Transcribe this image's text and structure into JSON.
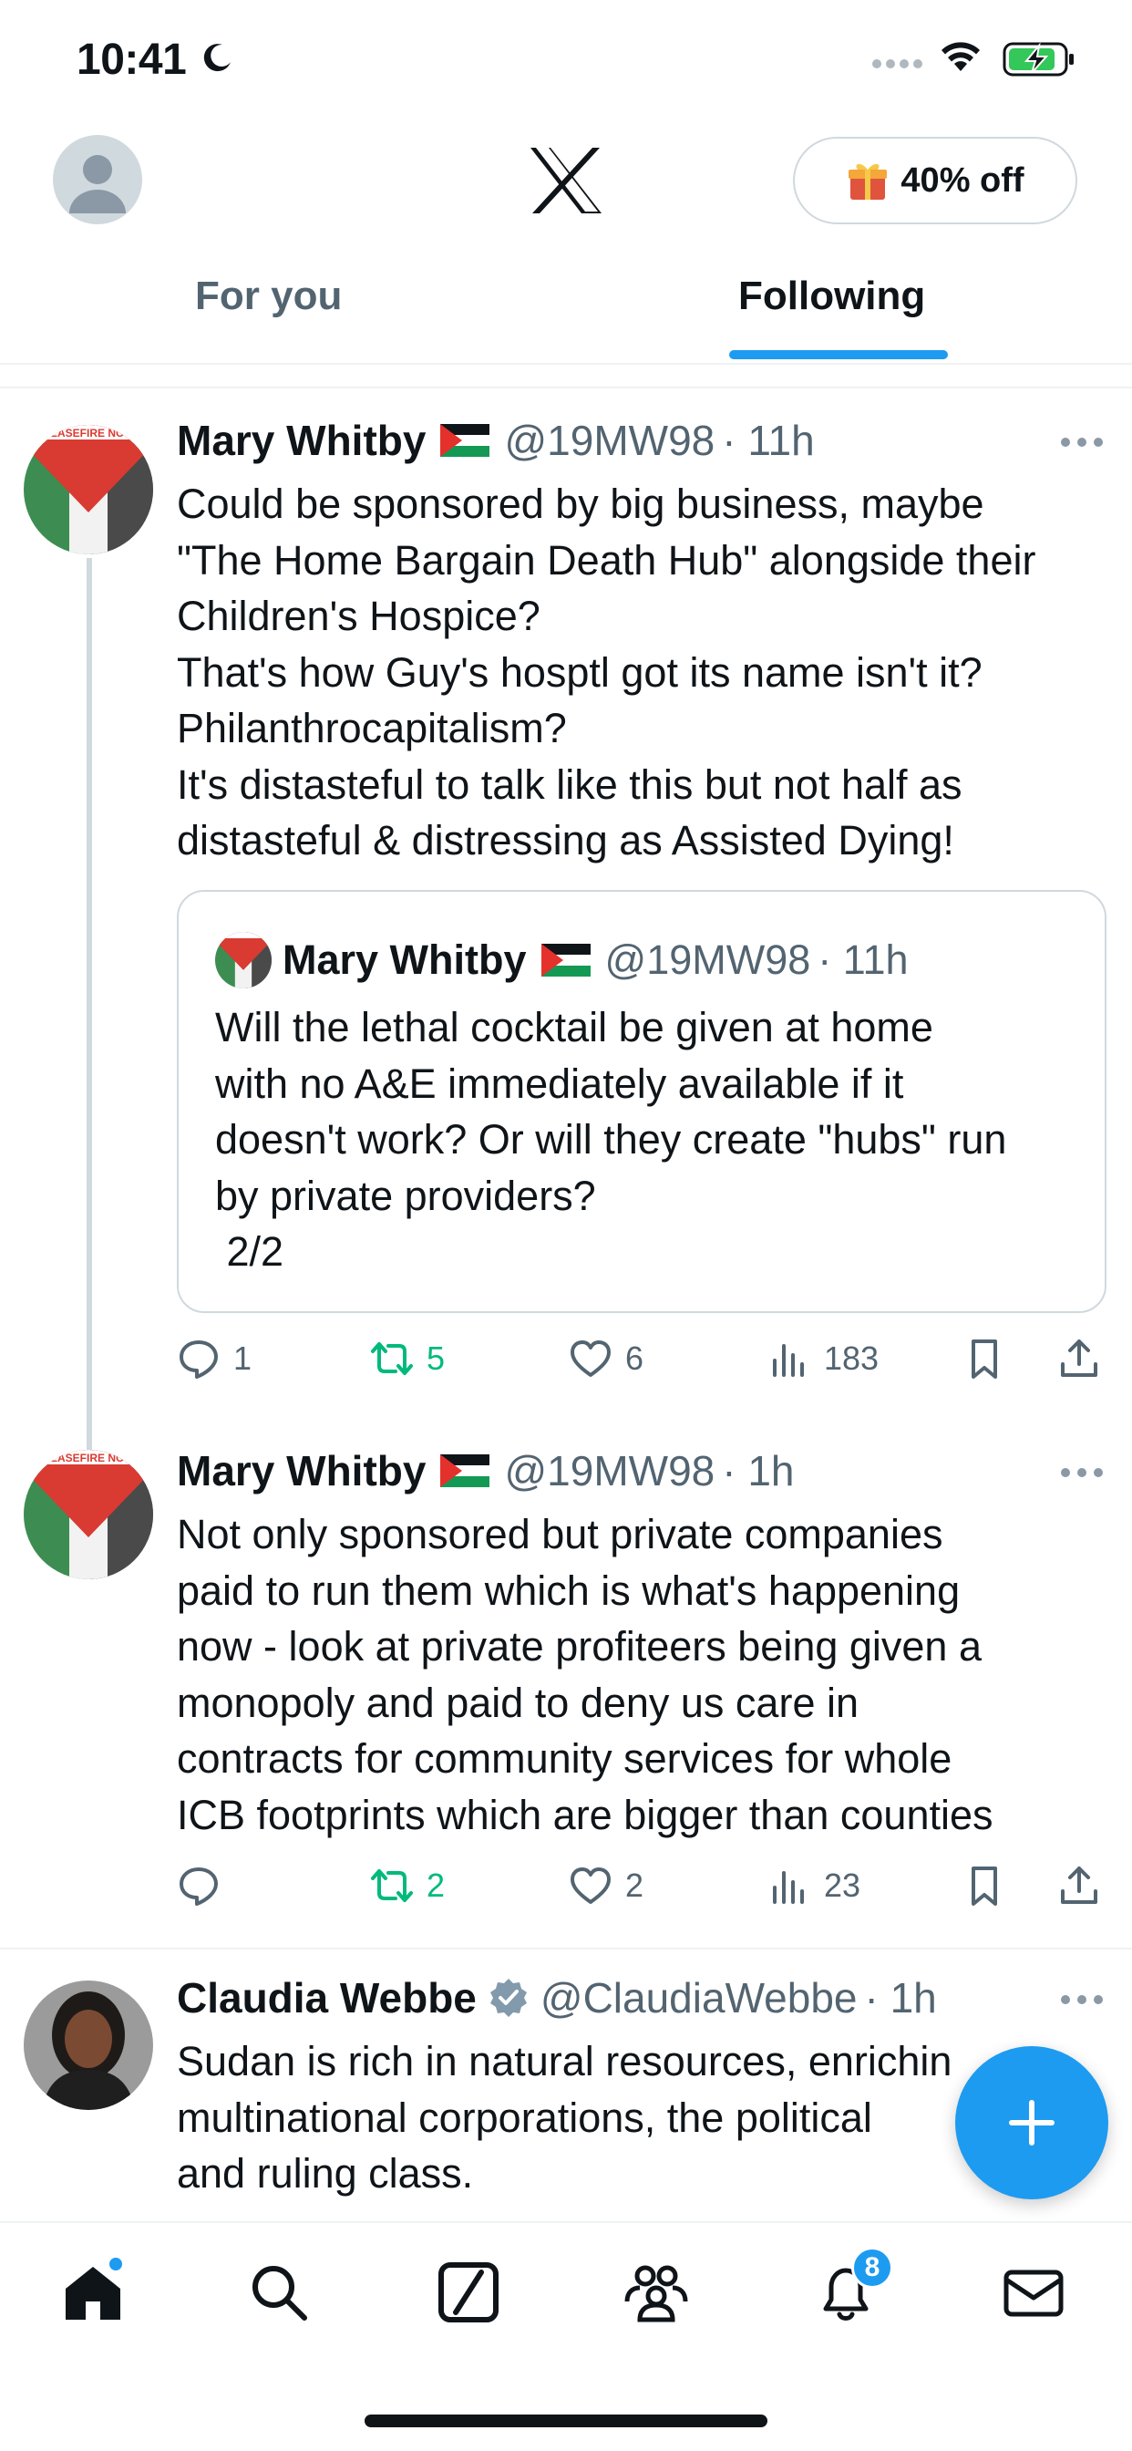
{
  "status_bar": {
    "time": "10:41"
  },
  "header": {
    "promo_label": "40% off"
  },
  "tabs": [
    {
      "label": "For you",
      "selected": false
    },
    {
      "label": "Following",
      "selected": true
    }
  ],
  "tweets": [
    {
      "name": "Mary Whitby",
      "handle": "@19MW98",
      "time": "· 11h",
      "body_lines": [
        "Could be sponsored by big business, maybe",
        "\"The Home Bargain  Death Hub\"  alongside their",
        "Children's Hospice?",
        "That's how Guy's hosptl got its name isn't it?",
        "Philanthrocapitalism?",
        "It's distasteful to talk like this but not half as",
        "distasteful & distressing as Assisted Dying!"
      ],
      "quote": {
        "name": "Mary Whitby",
        "handle": "@19MW98",
        "time": "· 11h",
        "body_lines": [
          "Will the lethal cocktail be given at home",
          "with no A&E immediately available if it",
          "doesn't work? Or will they create \"hubs\" run",
          "by private providers?",
          " 2/2"
        ]
      },
      "replies": "1",
      "retweets": "5",
      "likes": "6",
      "views": "183"
    },
    {
      "name": "Mary Whitby",
      "handle": "@19MW98",
      "time": "· 1h",
      "body_lines": [
        "Not only sponsored but private companies",
        "paid to run them which is what's happening",
        "now - look at private profiteers being given a",
        "monopoly and paid to deny us care in",
        "contracts for community services for whole",
        "ICB footprints which are bigger than counties"
      ],
      "replies": "",
      "retweets": "2",
      "likes": "2",
      "views": "23"
    },
    {
      "name": "Claudia Webbe",
      "handle": "@ClaudiaWebbe",
      "time": "· 1h",
      "verified": true,
      "body_lines": [
        "Sudan is rich in natural resources, enrichin",
        "multinational corporations, the political",
        "and ruling class."
      ]
    }
  ],
  "bottom_nav": {
    "notifications_badge": "8"
  },
  "colors": {
    "accent": "#1d9bf0",
    "retweet": "#00ba7c",
    "muted": "#536471"
  }
}
